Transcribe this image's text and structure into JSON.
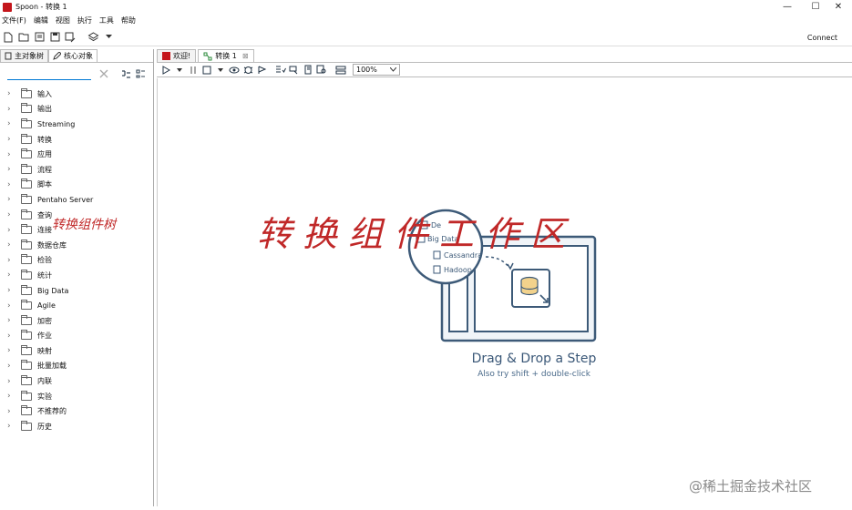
{
  "window": {
    "title": "Spoon - 转换 1",
    "minimize": "—",
    "maximize": "☐",
    "close": "✕"
  },
  "menu": [
    "文件(F)",
    "编辑",
    "视图",
    "执行",
    "工具",
    "帮助"
  ],
  "toolbar": {
    "connect": "Connect"
  },
  "left_tabs": [
    "主对象树",
    "核心对象"
  ],
  "search": {
    "value": "",
    "placeholder": ""
  },
  "tree": [
    "输入",
    "输出",
    "Streaming",
    "转换",
    "应用",
    "流程",
    "脚本",
    "Pentaho Server",
    "查询",
    "连接",
    "数据仓库",
    "检验",
    "统计",
    "Big Data",
    "Agile",
    "加密",
    "作业",
    "映射",
    "批量加载",
    "内联",
    "实验",
    "不推荐的",
    "历史"
  ],
  "right_tabs": [
    "欢迎!",
    "转换 1"
  ],
  "zoom": "100%",
  "canvas": {
    "dd_title": "Drag & Drop a Step",
    "dd_subtitle": "Also try shift + double-click",
    "illus_items": [
      "De",
      "Big Data",
      "Cassandra",
      "Hadoop"
    ]
  },
  "annotations": {
    "left": "转换组件树",
    "main": "转换组件工作区"
  },
  "watermark": "@稀土掘金技术社区",
  "colors": {
    "brand": "#c4161c",
    "accent": "#0078d4",
    "annotation": "#c02828"
  }
}
